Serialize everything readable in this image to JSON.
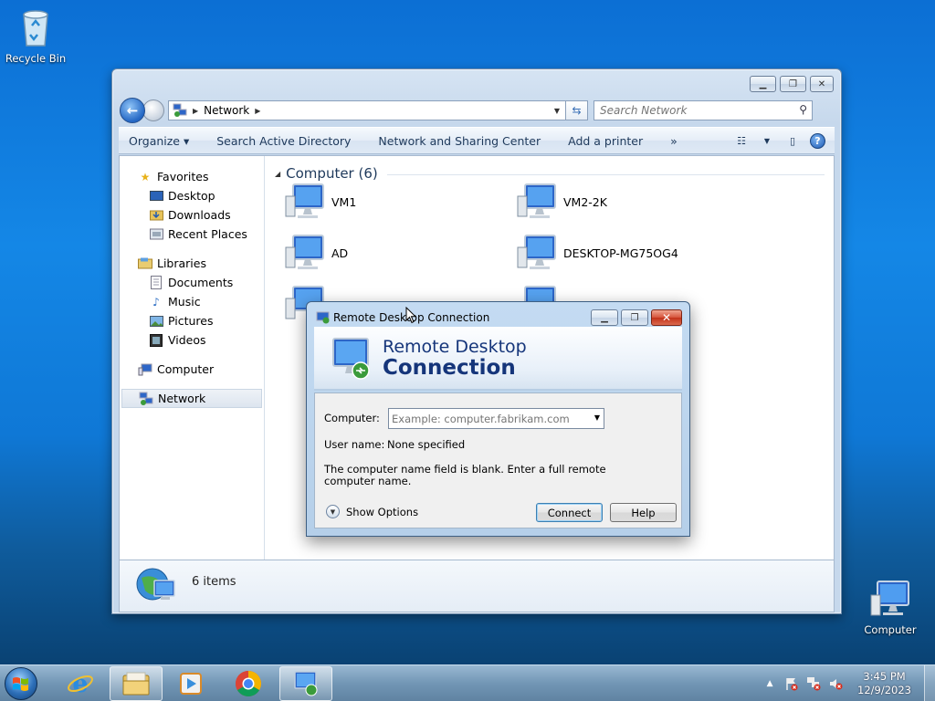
{
  "desktop": {
    "icons": [
      {
        "label": "Recycle Bin",
        "icon": "recycle-bin-icon"
      },
      {
        "label": "Computer",
        "icon": "computer-icon"
      }
    ]
  },
  "explorer": {
    "breadcrumb": "Network",
    "search_placeholder": "Search Network",
    "commands": [
      "Organize",
      "Search Active Directory",
      "Network and Sharing Center",
      "Add a printer",
      "»"
    ],
    "nav": {
      "favorites": "Favorites",
      "favorites_items": [
        "Desktop",
        "Downloads",
        "Recent Places"
      ],
      "libraries": "Libraries",
      "libraries_items": [
        "Documents",
        "Music",
        "Pictures",
        "Videos"
      ],
      "computer": "Computer",
      "network": "Network"
    },
    "group_header": "Computer (6)",
    "computers": [
      "VM1",
      "VM2-2K",
      "AD",
      "DESKTOP-MG75OG4"
    ],
    "status": "6 items"
  },
  "rdp": {
    "title": "Remote Desktop Connection",
    "banner_line1": "Remote Desktop",
    "banner_line2": "Connection",
    "computer_label": "Computer:",
    "computer_placeholder": "Example: computer.fabrikam.com",
    "username_label": "User name:",
    "username_value": "None specified",
    "note": "The computer name field is blank. Enter a full remote computer name.",
    "show_options": "Show Options",
    "connect": "Connect",
    "help": "Help"
  },
  "taskbar": {
    "time": "3:45 PM",
    "date": "12/9/2023"
  },
  "colors": {
    "accent": "#15357a",
    "link": "#1e395b"
  }
}
